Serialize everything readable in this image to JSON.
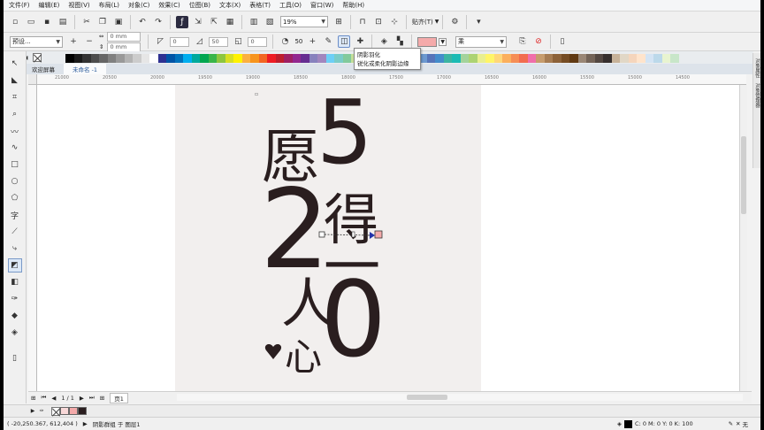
{
  "menu": [
    "文件(F)",
    "编辑(E)",
    "视图(V)",
    "布局(L)",
    "对象(C)",
    "效果(C)",
    "位图(B)",
    "文本(X)",
    "表格(T)",
    "工具(O)",
    "窗口(W)",
    "帮助(H)"
  ],
  "toolbar": {
    "zoom": "19%",
    "snap_label": "贴齐(T)"
  },
  "property_bar": {
    "preset": "预设...",
    "width_value": "0 mm",
    "height_value": "0 mm",
    "opacity_value": "0",
    "field2": "50",
    "field3": "0",
    "feather_value": "50",
    "shadow_color": "#f4aaaa",
    "merge_mode": "乘"
  },
  "tooltip": {
    "title": "阴影羽化",
    "description": "锐化或柔化阴影边缘"
  },
  "doc_tabs": [
    "欢迎屏幕",
    "未命名 -1"
  ],
  "ruler_ticks": [
    "21000",
    "20500",
    "20000",
    "19500",
    "19000",
    "18500",
    "18000",
    "17500",
    "17000",
    "16500",
    "16000",
    "15500",
    "15000",
    "14500"
  ],
  "artwork": {
    "char_wish": "愿",
    "digit5": "5",
    "digit2": "2",
    "char_de": "得",
    "char_yi": "一",
    "char_ren": "人",
    "digit0": "0",
    "char_xin": "心",
    "ink_color": "#2a1e1f"
  },
  "page_nav": {
    "counter": "1 / 1",
    "page_tab": "页1"
  },
  "status": {
    "coords": "( -20,250.367, 612,404 )",
    "info": "阴影群组 于 图层1",
    "fill_text": "C: 0 M: 0 Y: 0 K: 100",
    "outline_text": "无"
  },
  "right_dock": [
    "对象属性",
    "对象管理器"
  ],
  "palette_colors": [
    "#000000",
    "#1a1a1a",
    "#333333",
    "#4d4d4d",
    "#666666",
    "#808080",
    "#999999",
    "#b3b3b3",
    "#cccccc",
    "#e6e6e6",
    "#ffffff",
    "#2e3192",
    "#0054a6",
    "#0072bc",
    "#00aeef",
    "#00a99d",
    "#00a651",
    "#39b54a",
    "#8dc63f",
    "#d7df23",
    "#fff200",
    "#fbb040",
    "#f7941d",
    "#f26522",
    "#ed1c24",
    "#be1e2d",
    "#9e1f63",
    "#92278f",
    "#662d91",
    "#8781bd",
    "#a186be",
    "#6dcff6",
    "#7accc8",
    "#82ca9c",
    "#c4df9b",
    "#fff799",
    "#fdc689",
    "#f9ad81",
    "#f69679",
    "#f49ac2",
    "#bd8cbf",
    "#8393ca",
    "#6c99d0",
    "#5674b9",
    "#448ccb",
    "#3bb4a2",
    "#1cbbb4",
    "#a3d39c",
    "#acd373",
    "#e9ef8f",
    "#fff568",
    "#ffd779",
    "#fbaf5d",
    "#f68e56",
    "#f26c4f",
    "#f06eaa",
    "#c69c6d",
    "#a67c52",
    "#8c6239",
    "#754c24",
    "#603913",
    "#998675",
    "#736357",
    "#534741",
    "#362f2d",
    "#c7b299",
    "#e1d7c6",
    "#f5d5bc",
    "#ffe4cc",
    "#d4e4f4",
    "#bcd9ea",
    "#e8f4d0",
    "#c8e6c9"
  ]
}
